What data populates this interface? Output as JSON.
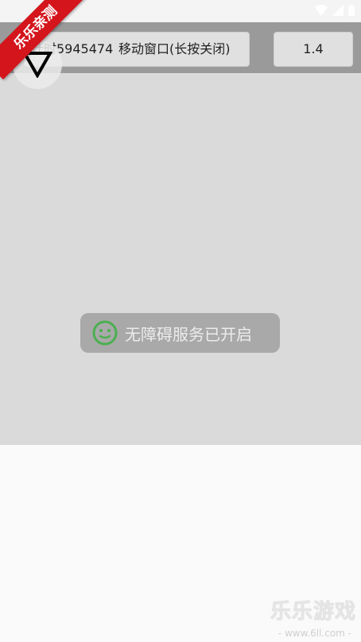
{
  "status_bar": {
    "icons": [
      "wifi-icon",
      "signal-icon",
      "battery-icon"
    ]
  },
  "float_window": {
    "move_button": {
      "counter": "计时5945474",
      "label": "移动窗口(长按关闭)"
    },
    "speed_button": {
      "label": "1.4"
    },
    "collapse_icon": "triangle-down-icon"
  },
  "toast": {
    "icon": "smile-face-icon",
    "icon_color": "#4caf50",
    "message": "无障碍服务已开启"
  },
  "badge": {
    "text": "乐乐亲测",
    "color": "#d4151c"
  },
  "watermark": {
    "title": "乐乐游戏",
    "url": "- www.6ll.com -"
  }
}
